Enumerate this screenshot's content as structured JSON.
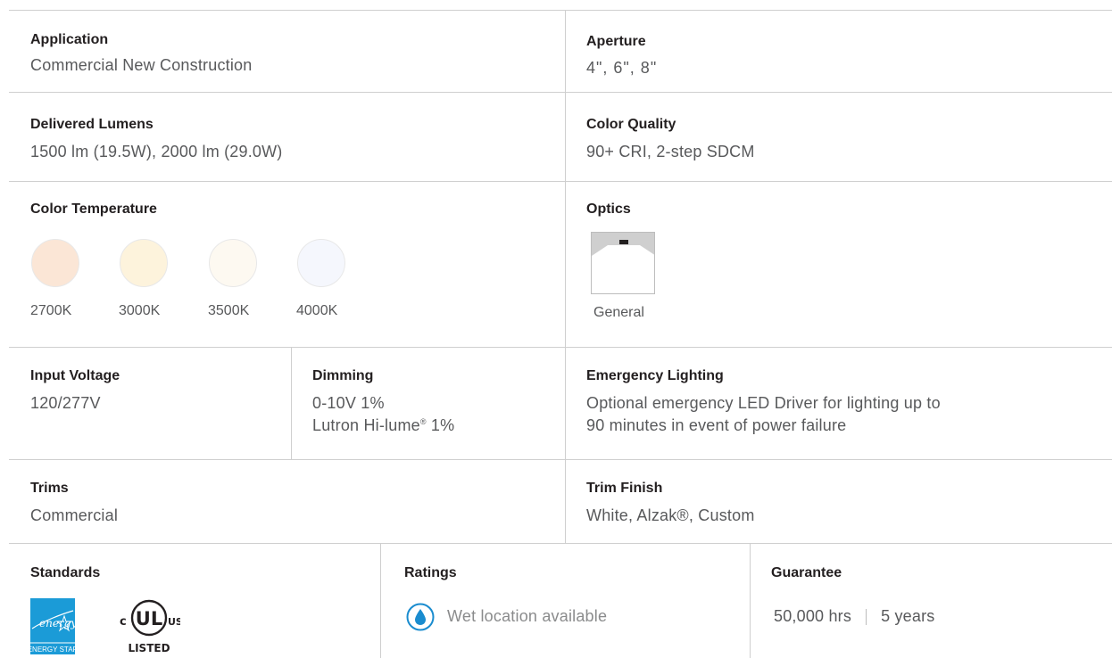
{
  "rows": {
    "application": {
      "label": "Application",
      "value": "Commercial New Construction"
    },
    "aperture": {
      "label": "Aperture",
      "value": "4\", 6\", 8\""
    },
    "delivered_lumens": {
      "label": "Delivered Lumens",
      "value": "1500 lm (19.5W), 2000 lm (29.0W)"
    },
    "color_quality": {
      "label": "Color Quality",
      "value": "90+ CRI, 2-step SDCM"
    },
    "color_temperature": {
      "label": "Color Temperature",
      "swatches": [
        {
          "label": "2700K",
          "color": "#fbe6d6"
        },
        {
          "label": "3000K",
          "color": "#fdf3dc"
        },
        {
          "label": "3500K",
          "color": "#fdf9f1"
        },
        {
          "label": "4000K",
          "color": "#f5f7fd"
        }
      ]
    },
    "optics": {
      "label": "Optics",
      "option": "General"
    },
    "input_voltage": {
      "label": "Input Voltage",
      "value": "120/277V"
    },
    "dimming": {
      "label": "Dimming",
      "line1": "0-10V 1%",
      "line2_pre": "Lutron Hi-lume",
      "line2_reg": "®",
      "line2_post": " 1%"
    },
    "emergency_lighting": {
      "label": "Emergency Lighting",
      "line1": "Optional emergency LED Driver for lighting up to",
      "line2": "90 minutes in event of power failure"
    },
    "trims": {
      "label": "Trims",
      "value": "Commercial"
    },
    "trim_finish": {
      "label": "Trim Finish",
      "value": "White, Alzak®, Custom"
    },
    "standards": {
      "label": "Standards",
      "energy_star_text": "ENERGY STAR",
      "energy_star_script": "energy",
      "ul_c": "c",
      "ul_us": "US",
      "ul_listed": "LISTED",
      "ul_mark": "UL"
    },
    "ratings": {
      "label": "Ratings",
      "value": "Wet location available",
      "icon": "water-drop-icon"
    },
    "guarantee": {
      "label": "Guarantee",
      "hours": "50,000 hrs",
      "years": "5 years"
    }
  },
  "colors": {
    "text": "#58595b",
    "label": "#231f20",
    "divider": "#cfcfcf",
    "energy_star_blue": "#1b9bd7",
    "ratings_blue": "#1a8ccf"
  }
}
